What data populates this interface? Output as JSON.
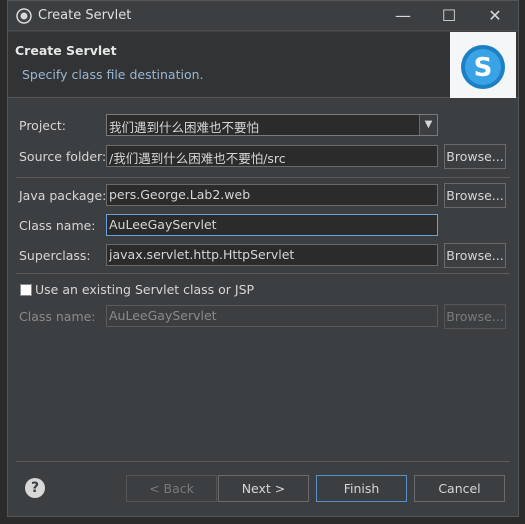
{
  "window": {
    "title": "Create Servlet"
  },
  "header": {
    "title": "Create Servlet",
    "subtitle": "Specify class file destination."
  },
  "form": {
    "project": {
      "label": "Project:",
      "value": "我们遇到什么困难也不要怕"
    },
    "source_folder": {
      "label": "Source folder:",
      "value": "/我们遇到什么困难也不要怕/src",
      "browse": "Browse..."
    },
    "java_package": {
      "label": "Java package:",
      "value": "pers.George.Lab2.web",
      "browse": "Browse..."
    },
    "class_name": {
      "label": "Class name:",
      "value": "AuLeeGayServlet"
    },
    "superclass": {
      "label": "Superclass:",
      "value": "javax.servlet.http.HttpServlet",
      "browse": "Browse..."
    },
    "use_existing": {
      "label": "Use an existing Servlet class or JSP",
      "checked": false
    },
    "existing_class_name": {
      "label": "Class name:",
      "value": "AuLeeGayServlet",
      "browse": "Browse..."
    }
  },
  "footer": {
    "back": "< Back",
    "next": "Next >",
    "finish": "Finish",
    "cancel": "Cancel"
  },
  "icons": {
    "app": "eclipse-icon",
    "logo": "servlet-wizard-logo",
    "help": "help-icon"
  }
}
